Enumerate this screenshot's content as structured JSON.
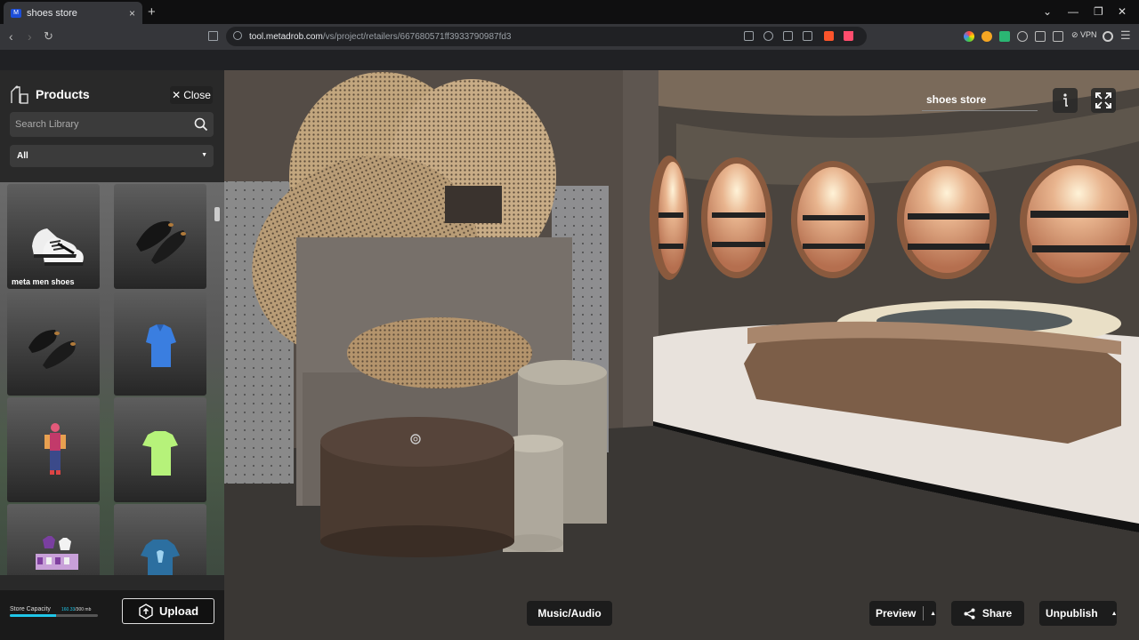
{
  "browser": {
    "tab_title": "shoes store",
    "tab_close": "×",
    "new_tab": "+",
    "url_host": "tool.metadrob.com",
    "url_path": "/vs/project/retailers/667680571ff3933790987fd3",
    "vpn_label": "VPN",
    "nav_back": "‹",
    "nav_forward": "›",
    "nav_reload": "↻",
    "win_min": "—",
    "win_restore": "❐",
    "win_close": "✕",
    "menu": "☰",
    "chevron": "⌄"
  },
  "panel": {
    "title": "Products",
    "close_label": "Close",
    "search_placeholder": "Search Library",
    "category_selected": "All",
    "items": [
      {
        "label": "meta men shoes",
        "icon": "sneaker-icon"
      },
      {
        "label": "",
        "icon": "loafer-icon"
      },
      {
        "label": "",
        "icon": "loafer-icon"
      },
      {
        "label": "",
        "icon": "shirt-icon"
      },
      {
        "label": "",
        "icon": "avatar-icon"
      },
      {
        "label": "",
        "icon": "tshirt-icon"
      },
      {
        "label": "",
        "icon": "clothing-rack-icon"
      },
      {
        "label": "",
        "icon": "tshirt-icon"
      }
    ],
    "capacity_label": "Store Capacity",
    "capacity_used": "160.33",
    "capacity_total": "/300 mb",
    "capacity_fraction": 0.53,
    "upload_label": "Upload"
  },
  "viewport": {
    "store_name": "shoes store",
    "music_label": "Music/Audio",
    "preview_label": "Preview",
    "share_label": "Share",
    "unpublish_label": "Unpublish"
  },
  "colors": {
    "accent": "#20c6e8",
    "panel_bg": "#282828"
  }
}
